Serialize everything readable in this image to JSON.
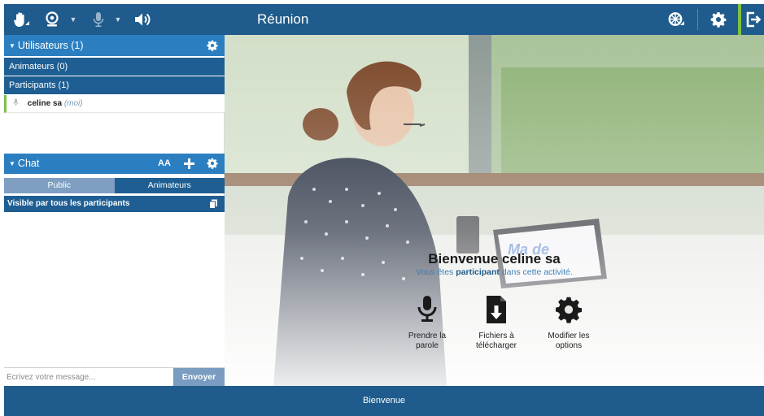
{
  "topbar": {
    "title": "Réunion",
    "icons": [
      "raise-hand-icon",
      "webcam-icon",
      "microphone-icon",
      "speaker-icon",
      "wheel-icon",
      "gear-icon",
      "exit-icon"
    ]
  },
  "sidebar": {
    "users_header": "Utilisateurs (1)",
    "animators_row": "Animateurs (0)",
    "participants_row": "Participants (1)",
    "user": {
      "name": "celine sa",
      "tag": "(moi)"
    },
    "chat_header": "Chat",
    "font_size_label": "AA",
    "tabs": [
      {
        "label": "Public"
      },
      {
        "label": "Animateurs"
      }
    ],
    "visible_label": "Visible par tous les participants",
    "input_placeholder": "Écrivez votre message...",
    "send_label": "Envoyer"
  },
  "main": {
    "welcome_title": "Bienvenue celine sa",
    "welcome_sub_prefix": "Vous êtes",
    "welcome_sub_role": "participant",
    "welcome_sub_suffix": "dans cette activité.",
    "actions": [
      {
        "line1": "Prendre la",
        "line2": "parole",
        "icon": "microphone-icon"
      },
      {
        "line1": "Fichiers à",
        "line2": "télécharger",
        "icon": "download-file-icon"
      },
      {
        "line1": "Modifier les",
        "line2": "options",
        "icon": "gear-icon"
      }
    ]
  },
  "bottombar": {
    "label": "Bienvenue"
  },
  "colors": {
    "primary": "#1f5b8c",
    "header": "#2b7fc1",
    "accent": "#7dc242",
    "send": "#7a9cc0"
  }
}
